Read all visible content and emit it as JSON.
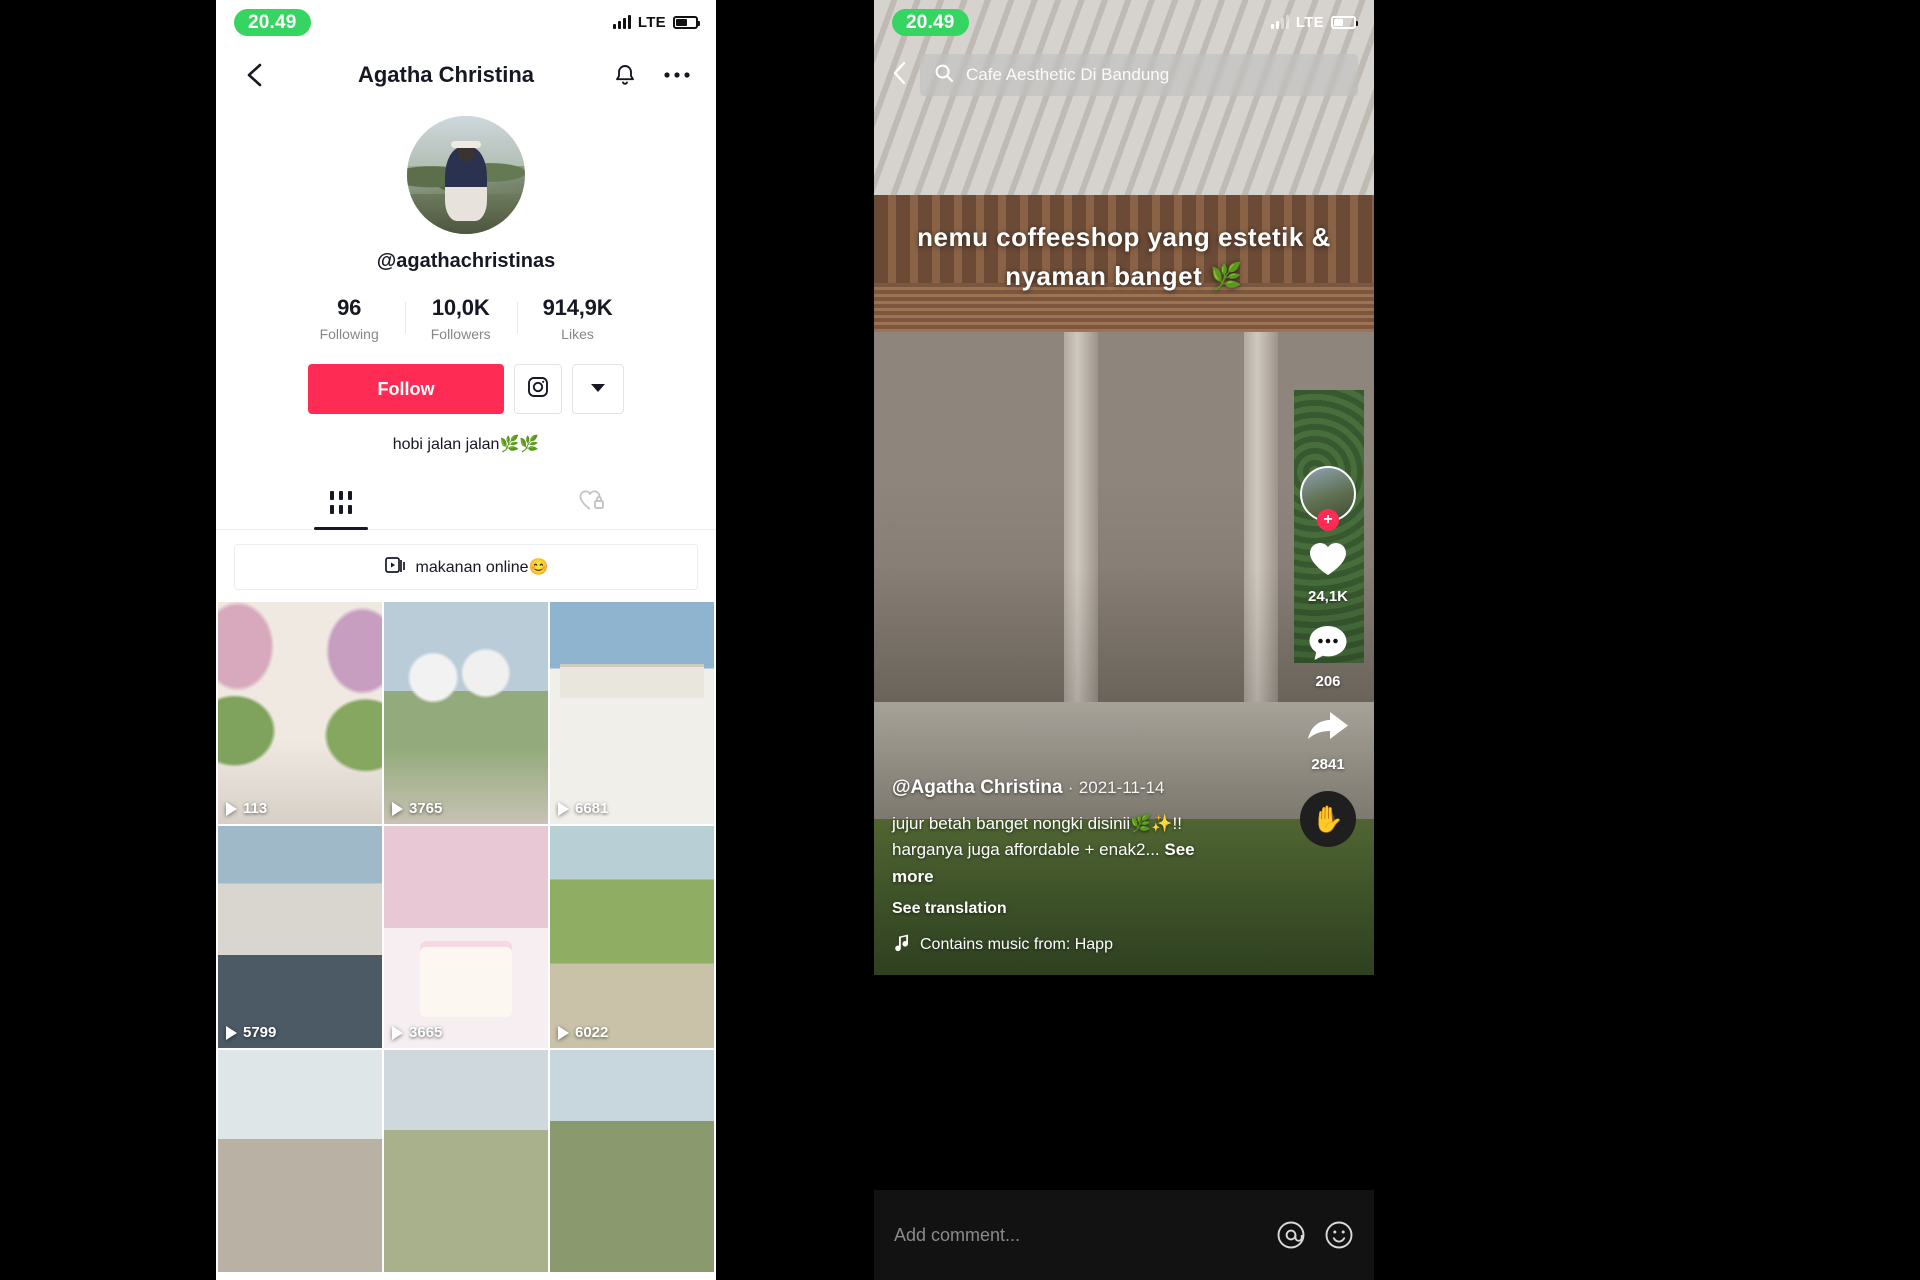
{
  "profile_phone": {
    "status_bar": {
      "time": "20.49",
      "network": "LTE",
      "time_pill_color": "#36D461"
    },
    "nav": {
      "back_icon": "chevron-left-icon",
      "title": "Agatha Christina",
      "bell_icon": "bell-icon",
      "more_icon": "more-horizontal-icon"
    },
    "handle": "@agathachristinas",
    "stats": [
      {
        "value": "96",
        "label": "Following"
      },
      {
        "value": "10,0K",
        "label": "Followers"
      },
      {
        "value": "914,9K",
        "label": "Likes"
      }
    ],
    "actions": {
      "follow_label": "Follow",
      "follow_color": "#FE2C55",
      "instagram_icon": "instagram-icon",
      "dropdown_icon": "chevron-down-icon"
    },
    "bio": "hobi jalan jalan🌿🌿",
    "tabs": [
      {
        "icon": "grid-icon",
        "active": true
      },
      {
        "icon": "heart-lock-icon",
        "active": false
      }
    ],
    "playlist": {
      "icon": "playlist-icon",
      "label": "makanan online😊"
    },
    "videos": [
      {
        "views": "113",
        "thumb": "t1"
      },
      {
        "views": "3765",
        "thumb": "t2"
      },
      {
        "views": "6681",
        "thumb": "t3"
      },
      {
        "views": "5799",
        "thumb": "t4"
      },
      {
        "views": "3665",
        "thumb": "t5"
      },
      {
        "views": "6022",
        "thumb": "t6"
      },
      {
        "views": "",
        "thumb": "t7"
      },
      {
        "views": "",
        "thumb": "t8"
      },
      {
        "views": "",
        "thumb": "t9"
      }
    ]
  },
  "video_phone": {
    "status_bar": {
      "time": "20.49",
      "network": "LTE",
      "time_pill_color": "#36D461"
    },
    "search": {
      "back_icon": "chevron-left-icon",
      "search_icon": "search-icon",
      "query": "Cafe Aesthetic Di Bandung"
    },
    "sticker_text": "nemu coffeeshop yang estetik & nyaman banget 🌿",
    "rail": {
      "avatar_icon": "profile-avatar",
      "follow_plus": "+",
      "like_icon": "heart-icon",
      "like_count": "24,1K",
      "comment_icon": "comment-icon",
      "comment_count": "206",
      "share_icon": "share-arrow-icon",
      "share_count": "2841",
      "music_disc_icon": "music-disc-icon"
    },
    "meta": {
      "author": "@Agatha Christina",
      "date_separator": "·",
      "date": "2021-11-14",
      "caption_line1": "jujur betah banget nongki disinii🌿✨!!",
      "caption_line2": "harganya juga affordable + enak2...",
      "see_more": "See more",
      "see_translation": "See translation",
      "music_icon": "music-note-icon",
      "music_text": "Contains music from: Happ"
    },
    "comment_bar": {
      "placeholder": "Add comment...",
      "mention_icon": "at-sign-icon",
      "emoji_icon": "emoji-icon"
    }
  }
}
